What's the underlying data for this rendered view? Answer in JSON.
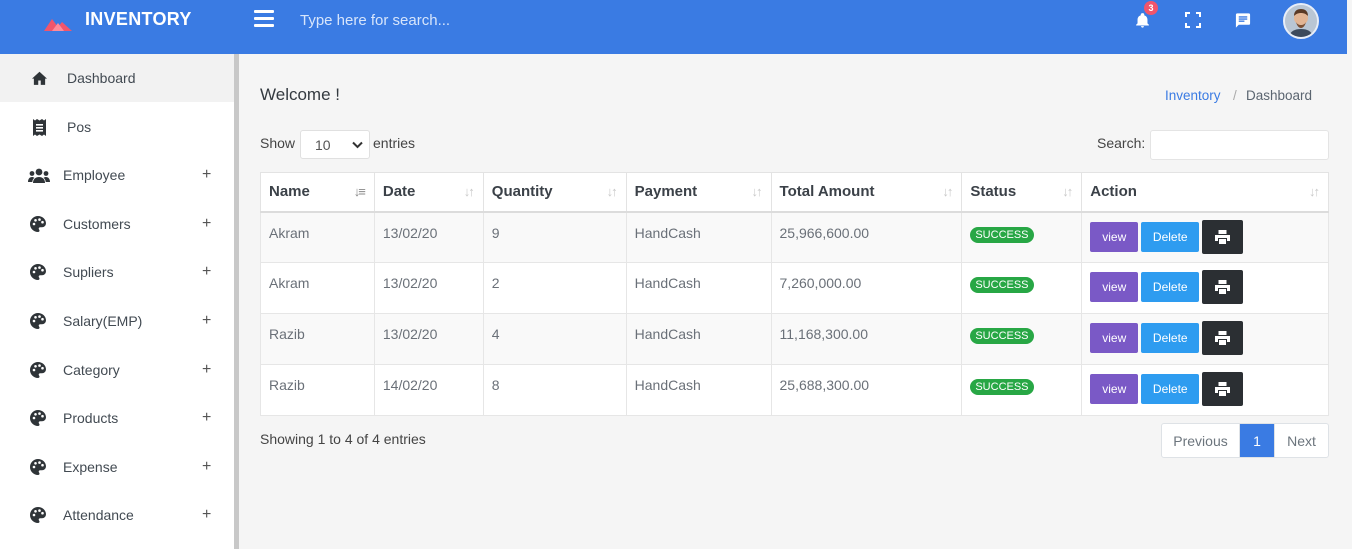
{
  "app": {
    "brand": "INVENTORY"
  },
  "header": {
    "search_placeholder": "Type here for search...",
    "notification_count": "3",
    "icons": [
      "hamburger-icon",
      "bell-icon",
      "fullscreen-icon",
      "chat-icon",
      "avatar"
    ]
  },
  "sidebar": {
    "items": [
      {
        "label": "Dashboard",
        "icon": "home-icon",
        "expandable": false,
        "active": true
      },
      {
        "label": "Pos",
        "icon": "receipt-icon",
        "expandable": false
      },
      {
        "label": "Employee",
        "icon": "users-icon",
        "expandable": true
      },
      {
        "label": "Customers",
        "icon": "palette-icon",
        "expandable": true
      },
      {
        "label": "Supliers",
        "icon": "palette-icon",
        "expandable": true
      },
      {
        "label": "Salary(EMP)",
        "icon": "palette-icon",
        "expandable": true
      },
      {
        "label": "Category",
        "icon": "palette-icon",
        "expandable": true
      },
      {
        "label": "Products",
        "icon": "palette-icon",
        "expandable": true
      },
      {
        "label": "Expense",
        "icon": "palette-icon",
        "expandable": true
      },
      {
        "label": "Attendance",
        "icon": "palette-icon",
        "expandable": true
      }
    ],
    "plus": "+"
  },
  "main": {
    "title": "Welcome !",
    "breadcrumb": {
      "link": "Inventory",
      "sep": "/",
      "current": "Dashboard"
    },
    "show_label": "Show",
    "entries_value": "10",
    "entries_label": "entries",
    "search_label": "Search:",
    "table": {
      "headers": [
        "Name",
        "Date",
        "Quantity",
        "Payment",
        "Total Amount",
        "Status",
        "Action"
      ],
      "rows": [
        {
          "name": "Akram",
          "date": "13/02/20",
          "quantity": "9",
          "payment": "HandCash",
          "total": "25,966,600.00",
          "status": "SUCCESS"
        },
        {
          "name": "Akram",
          "date": "13/02/20",
          "quantity": "2",
          "payment": "HandCash",
          "total": "7,260,000.00",
          "status": "SUCCESS"
        },
        {
          "name": "Razib",
          "date": "13/02/20",
          "quantity": "4",
          "payment": "HandCash",
          "total": "11,168,300.00",
          "status": "SUCCESS"
        },
        {
          "name": "Razib",
          "date": "14/02/20",
          "quantity": "8",
          "payment": "HandCash",
          "total": "25,688,300.00",
          "status": "SUCCESS"
        }
      ],
      "actions": {
        "view": "view",
        "delete": "Delete"
      }
    },
    "showing": "Showing 1 to 4 of 4 entries",
    "pagination": {
      "previous": "Previous",
      "page": "1",
      "next": "Next"
    }
  },
  "colors": {
    "primary": "#3a7be3",
    "success": "#28a745",
    "view": "#7a59c6",
    "delete": "#2e9cf0",
    "print": "#2b2f33",
    "badge": "#f1556c"
  }
}
